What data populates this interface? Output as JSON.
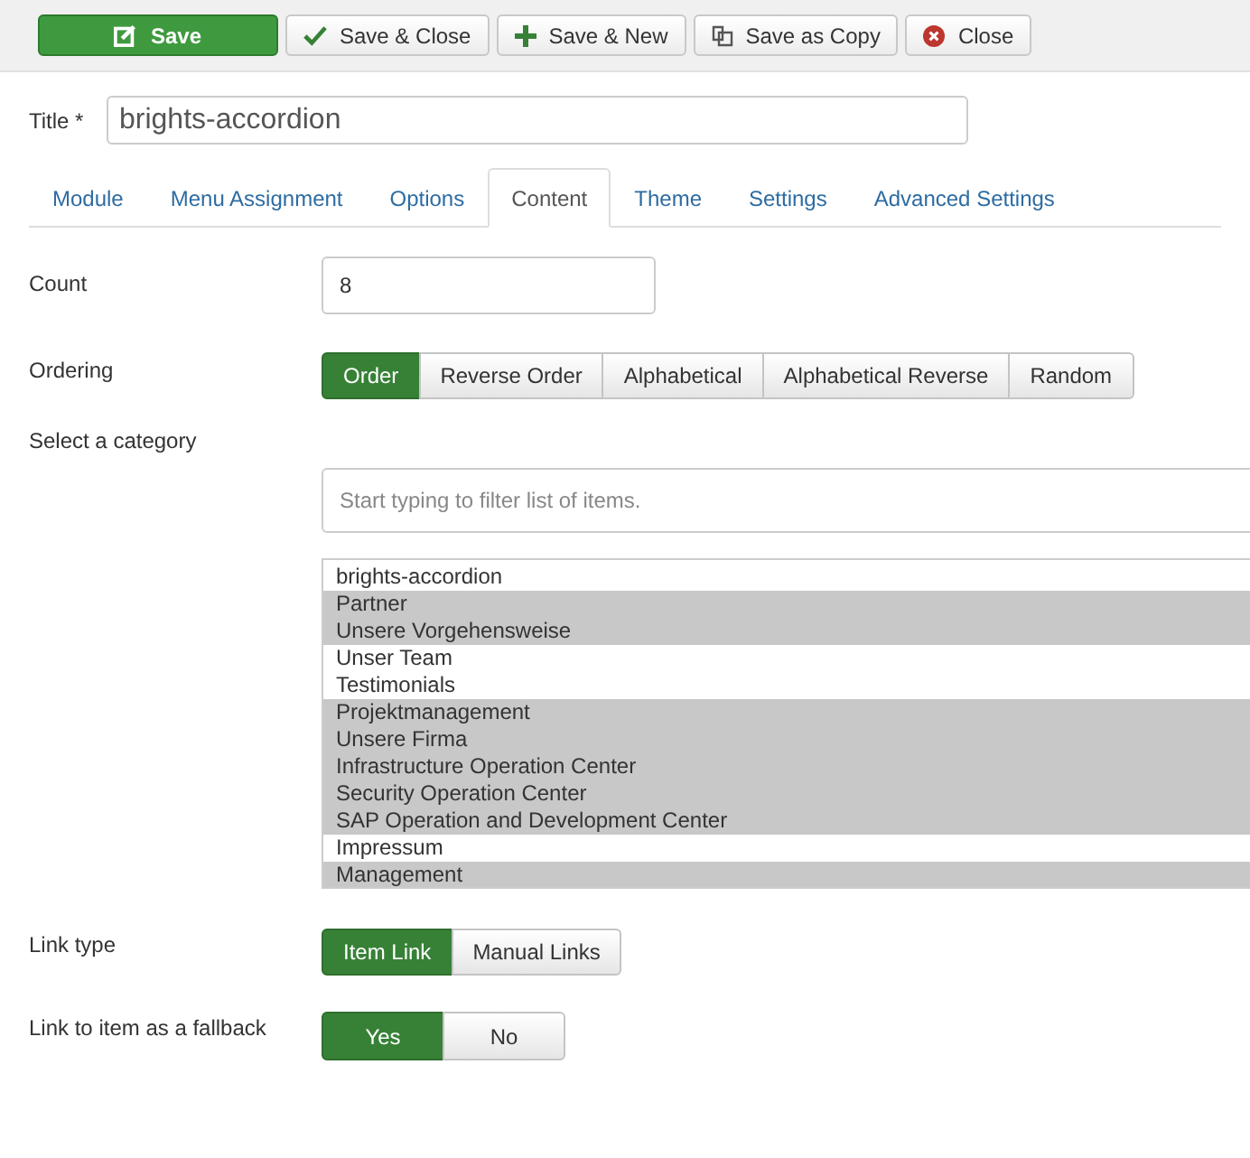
{
  "toolbar": [
    {
      "kind": "save",
      "label": "Save"
    },
    {
      "kind": "check",
      "label": "Save & Close"
    },
    {
      "kind": "plus",
      "label": "Save & New"
    },
    {
      "kind": "copy",
      "label": "Save as Copy"
    },
    {
      "kind": "close",
      "label": "Close"
    }
  ],
  "title": {
    "label": "Title *",
    "value": "brights-accordion"
  },
  "tabs": [
    {
      "label": "Module",
      "selected": false
    },
    {
      "label": "Menu Assignment",
      "selected": false
    },
    {
      "label": "Options",
      "selected": false
    },
    {
      "label": "Content",
      "selected": true
    },
    {
      "label": "Theme",
      "selected": false
    },
    {
      "label": "Settings",
      "selected": false
    },
    {
      "label": "Advanced Settings",
      "selected": false
    }
  ],
  "count": {
    "label": "Count",
    "value": "8"
  },
  "ordering": {
    "label": "Ordering",
    "options": [
      {
        "label": "Order",
        "selected": true
      },
      {
        "label": "Reverse Order",
        "selected": false
      },
      {
        "label": "Alphabetical",
        "selected": false
      },
      {
        "label": "Alphabetical Reverse",
        "selected": false
      },
      {
        "label": "Random",
        "selected": false
      }
    ]
  },
  "category": {
    "label": "Select a category",
    "placeholder": "Start typing to filter list of items.",
    "items": [
      {
        "label": "brights-accordion",
        "selected": false
      },
      {
        "label": "Partner",
        "selected": true
      },
      {
        "label": "Unsere Vorgehensweise",
        "selected": true
      },
      {
        "label": "Unser Team",
        "selected": false
      },
      {
        "label": "Testimonials",
        "selected": false
      },
      {
        "label": "Projektmanagement",
        "selected": true
      },
      {
        "label": "Unsere Firma",
        "selected": true
      },
      {
        "label": "Infrastructure Operation Center",
        "selected": true
      },
      {
        "label": "Security Operation Center",
        "selected": true
      },
      {
        "label": "SAP Operation and Development Center",
        "selected": true
      },
      {
        "label": "Impressum",
        "selected": false
      },
      {
        "label": "Management",
        "selected": true
      }
    ]
  },
  "link_type": {
    "label": "Link type",
    "options": [
      {
        "label": "Item Link",
        "selected": true
      },
      {
        "label": "Manual Links",
        "selected": false
      }
    ]
  },
  "fallback": {
    "label": "Link to item as a fallback",
    "options": [
      {
        "label": "Yes",
        "selected": true
      },
      {
        "label": "No",
        "selected": false
      }
    ]
  }
}
